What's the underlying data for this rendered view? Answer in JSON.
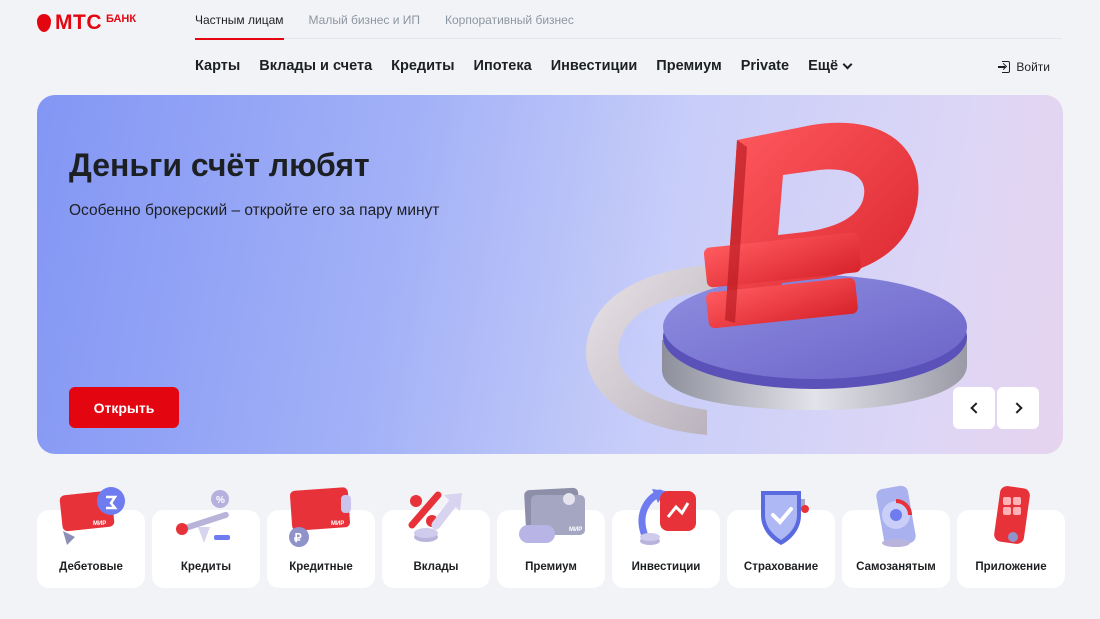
{
  "logo": {
    "text": "МТС",
    "sub": "БАНК"
  },
  "segments": [
    "Частным лицам",
    "Малый бизнес и ИП",
    "Корпоративный бизнес"
  ],
  "nav": {
    "items": [
      "Карты",
      "Вклады и счета",
      "Кредиты",
      "Ипотека",
      "Инвестиции",
      "Премиум",
      "Private"
    ],
    "more": "Ещё",
    "login": "Войти"
  },
  "banner": {
    "title": "Деньги счёт любят",
    "subtitle": "Особенно брокерский – откройте его за пару минут",
    "button": "Открыть"
  },
  "products": [
    {
      "label": "Дебетовые",
      "icon": "debit-card-icon"
    },
    {
      "label": "Кредиты",
      "icon": "credit-scale-icon"
    },
    {
      "label": "Кредитные",
      "icon": "credit-card-icon"
    },
    {
      "label": "Вклады",
      "icon": "deposit-percent-icon"
    },
    {
      "label": "Премиум",
      "icon": "premium-card-icon"
    },
    {
      "label": "Инвестиции",
      "icon": "investment-icon"
    },
    {
      "label": "Страхование",
      "icon": "insurance-shield-icon"
    },
    {
      "label": "Самозанятым",
      "icon": "self-employed-phone-icon"
    },
    {
      "label": "Приложение",
      "icon": "app-phone-icon"
    }
  ],
  "colors": {
    "brand": "#e30611",
    "page_bg": "#f2f3f7",
    "text": "#1d2023"
  }
}
